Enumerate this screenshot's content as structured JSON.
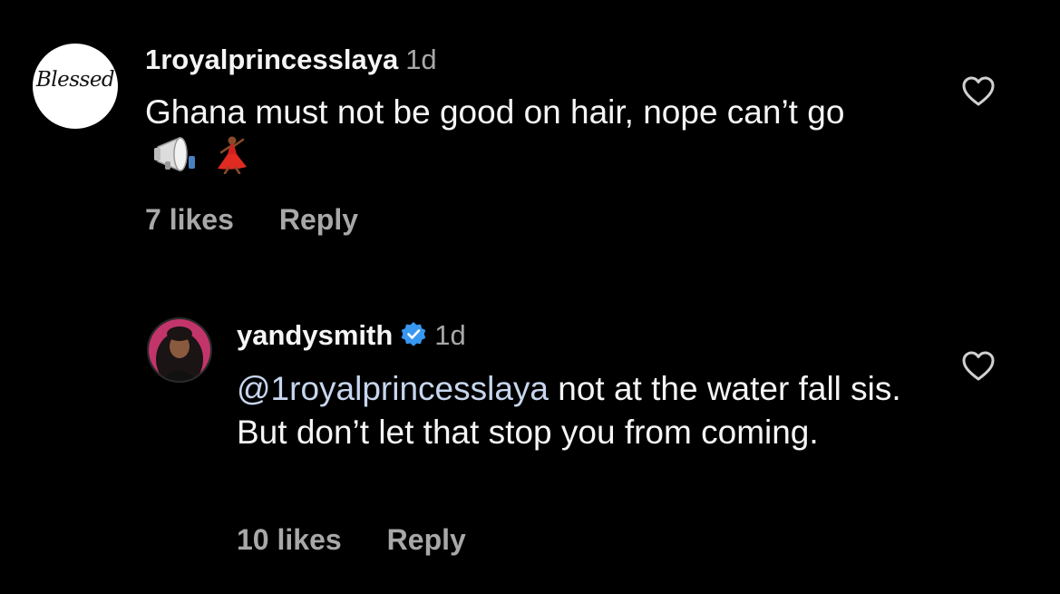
{
  "comments": [
    {
      "username": "1royalprincesslaya",
      "time": "1d",
      "avatar_logo_text": "Blessed",
      "text": "Ghana must not be good on hair, nope can’t go",
      "emojis": [
        "megaphone-icon",
        "dancer-icon"
      ],
      "likes": "7 likes",
      "reply_label": "Reply"
    },
    {
      "username": "yandysmith",
      "verified": true,
      "time": "1d",
      "mention": "@1royalprincesslaya",
      "text": " not at the water fall sis. But don’t let that stop you from coming.",
      "likes": "10 likes",
      "reply_label": "Reply"
    }
  ],
  "colors": {
    "background": "#000000",
    "primary_text": "#f5f5f5",
    "secondary_text": "#a8a8a8",
    "mention": "#c7d6ee",
    "verified_badge": "#3897f0",
    "heart_outline": "#d0d0d0"
  }
}
